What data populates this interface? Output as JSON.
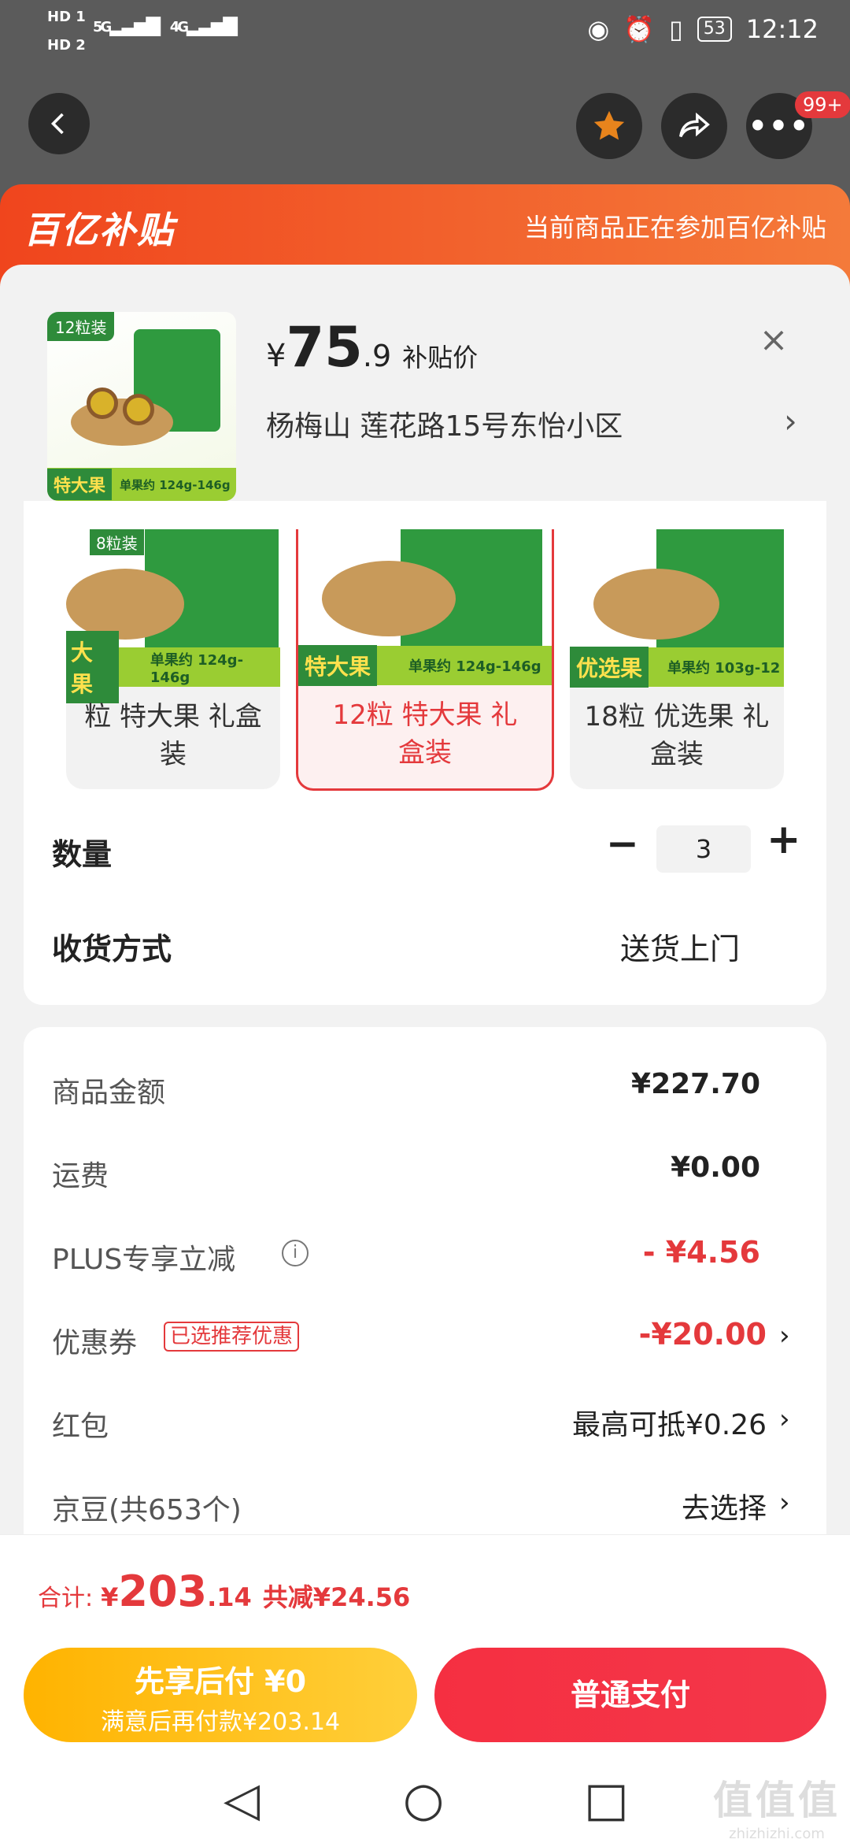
{
  "status": {
    "hd1": "HD 1",
    "hd2": "HD 2",
    "net1": "5G",
    "net2": "4G",
    "battery": "53",
    "time": "12:12"
  },
  "header": {
    "more_badge": "99+"
  },
  "banner": {
    "logo": "百亿补贴",
    "tip": "当前商品正在参加百亿补贴"
  },
  "product": {
    "thumb_tag": "12粒装",
    "thumb_label": "特大果",
    "thumb_sub": "单果约 124g-146g",
    "currency": "¥",
    "price_int": "75",
    "price_dec": ".9",
    "price_label": "补贴价",
    "address": "杨梅山  莲花路15号东怡小区",
    "chevron": "›",
    "close": "×"
  },
  "variants": [
    {
      "line1": "粒 特大果 礼盒",
      "line2": "装",
      "tag": "大果",
      "sub": "单果约 124g-146g",
      "box_tag": "8粒装",
      "selected": false
    },
    {
      "line1": "12粒 特大果 礼",
      "line2": "盒装",
      "tag": "特大果",
      "sub": "单果约 124g-146g",
      "selected": true
    },
    {
      "line1": "18粒 优选果 礼",
      "line2": "盒装",
      "tag": "优选果",
      "sub": "单果约 103g-12",
      "selected": false
    }
  ],
  "quantity": {
    "label": "数量",
    "minus": "−",
    "value": "3",
    "plus": "+"
  },
  "delivery": {
    "label": "收货方式",
    "value": "送货上门"
  },
  "fees": {
    "amount_label": "商品金额",
    "amount": "¥227.70",
    "shipping_label": "运费",
    "shipping": "¥0.00",
    "plus_label": "PLUS专享立减",
    "plus_info": "i",
    "plus": "- ¥4.56",
    "coupon_label": "优惠券",
    "coupon_tag": "已选推荐优惠",
    "coupon": "-¥20.00",
    "redpack_label": "红包",
    "redpack": "最高可抵¥0.26",
    "beans_label": "京豆(共653个)",
    "beans": "去选择"
  },
  "total": {
    "label": "合计:",
    "currency": "¥",
    "int": "203",
    "dec": ".14",
    "saved": "共减¥24.56"
  },
  "buttons": {
    "later_title": "先享后付 ¥0",
    "later_sub": "满意后再付款¥203.14",
    "pay": "普通支付"
  },
  "sysnav": {
    "back": "◁",
    "home": "○",
    "recent": "□"
  },
  "watermark": "值值值",
  "watermark_sub": "zhizhizhi.com",
  "colors": {
    "accent": "#e4393c",
    "banner": "#f0451d",
    "yellow": "#ffb300"
  }
}
